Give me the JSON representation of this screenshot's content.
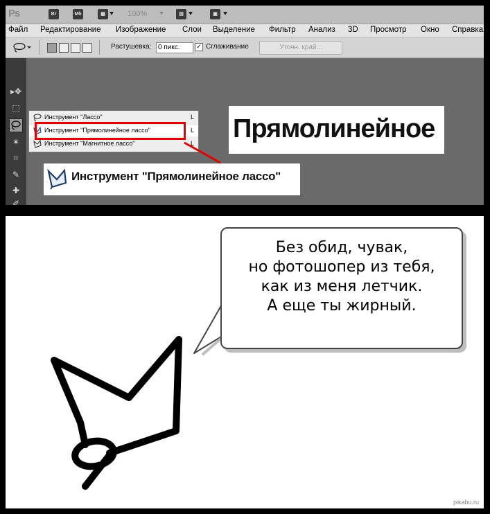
{
  "appbar": {
    "logo": "Ps",
    "bridge_icon": "Br",
    "minibridge_icon": "Mb",
    "zoom": "100%"
  },
  "menu": [
    "Файл",
    "Редактирование",
    "Изображение",
    "Слои",
    "Выделение",
    "Фильтр",
    "Анализ",
    "3D",
    "Просмотр",
    "Окно",
    "Справка"
  ],
  "options": {
    "feather_label": "Растушевка:",
    "feather_value": "0 пикс.",
    "antialias_label": "Сглаживание",
    "antialias_checked": true,
    "refine_edge_button": "Уточн. край..."
  },
  "flyout": {
    "items": [
      {
        "label": "Инструмент \"Лассо\"",
        "key": "L",
        "icon": "lasso-icon"
      },
      {
        "label": "Инструмент \"Прямолинейное лассо\"",
        "key": "L",
        "icon": "polygonal-lasso-icon",
        "selected": true
      },
      {
        "label": "Инструмент \"Магнитное лассо\"",
        "key": "L",
        "icon": "magnetic-lasso-icon"
      }
    ]
  },
  "zoomed_label": "Инструмент \"Прямолинейное лассо\"",
  "zoomed_word": "Прямолинейное",
  "speech": {
    "lines": [
      "Без обид, чувак,",
      "но фотошопер из тебя,",
      "как из меня летчик.",
      "А еще ты жирный."
    ]
  },
  "watermark": "pikabu.ru",
  "colors": {
    "highlight": "#e10000",
    "ps_chrome": "#bdbdbd",
    "canvas": "#6a6a6a"
  }
}
